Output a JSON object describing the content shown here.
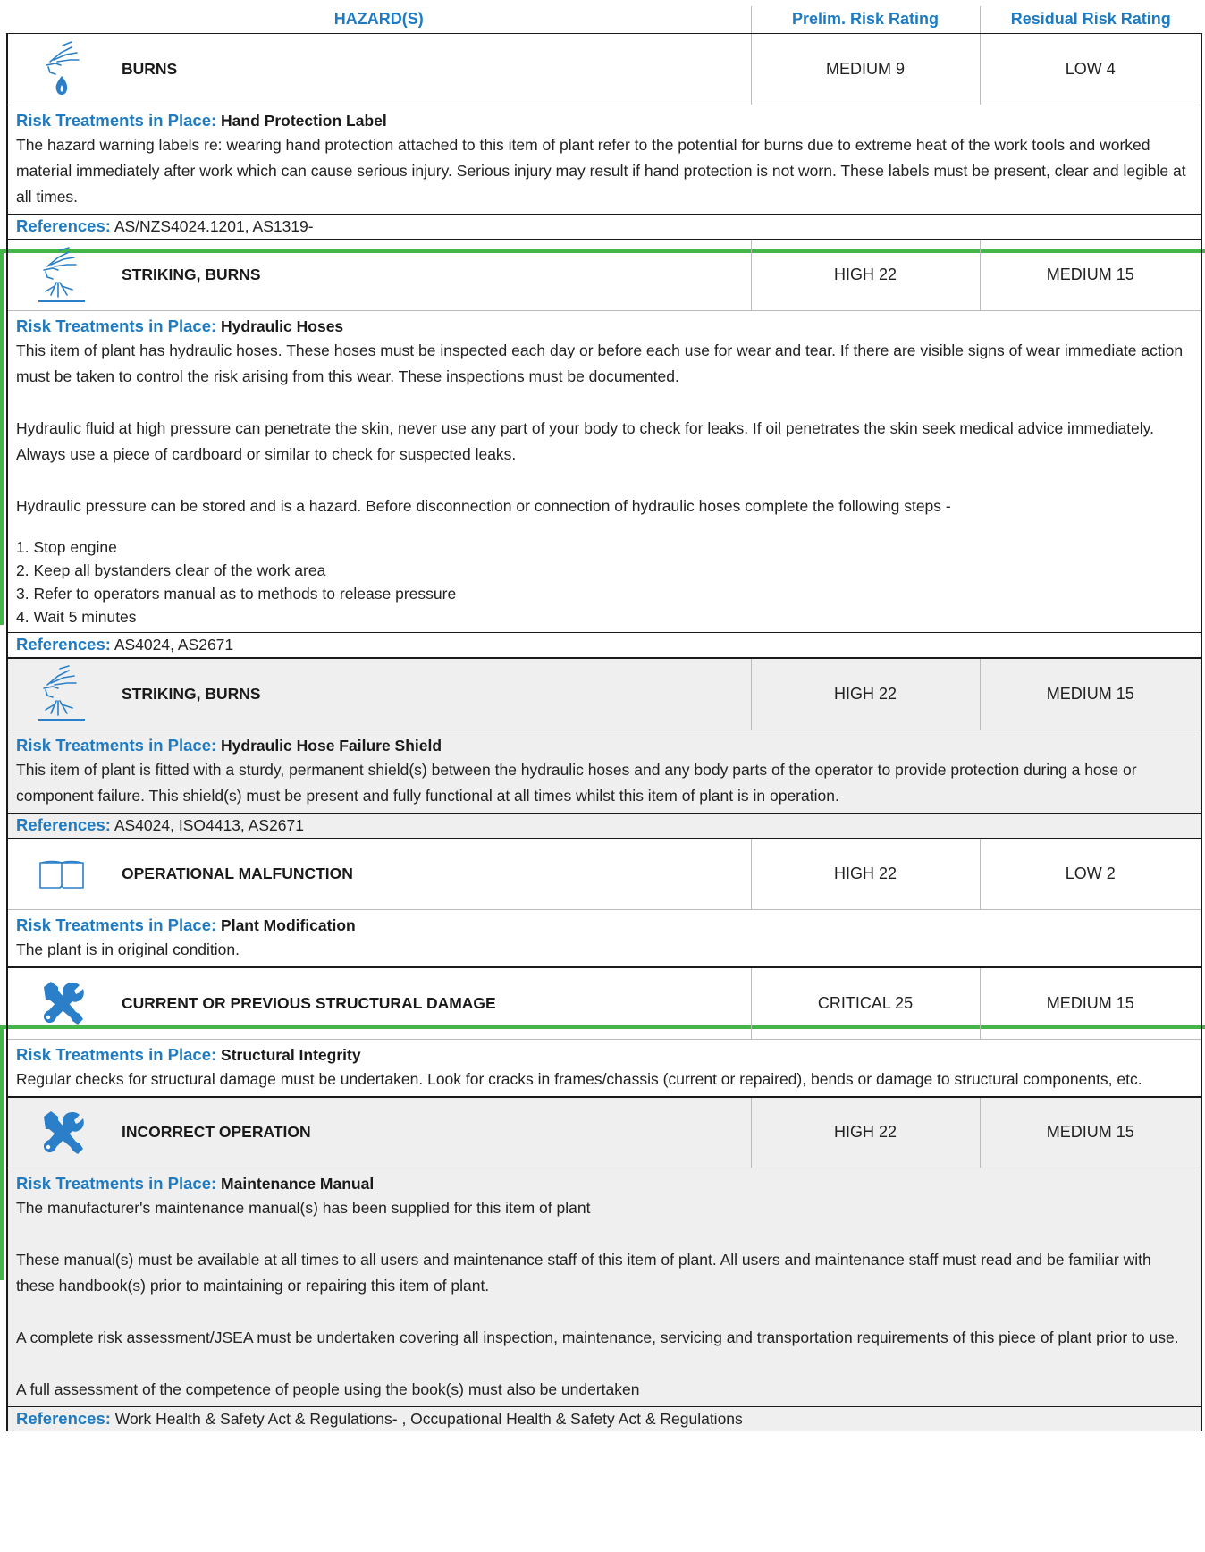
{
  "header": {
    "hazards": "HAZARD(S)",
    "prelim": "Prelim. Risk Rating",
    "residual": "Residual Risk Rating"
  },
  "labels": {
    "treatments": "Risk Treatments in Place:",
    "references": "References:"
  },
  "rows": [
    {
      "icon": "hand-burn-icon",
      "hazard": "BURNS",
      "prelim": "MEDIUM 9",
      "residual": "LOW 4",
      "treatment": "Hand Protection Label",
      "paragraphs": [
        "The hazard warning labels re: wearing hand protection attached to this item of plant refer to the potential for burns due to extreme heat of the work tools and worked material immediately after work which can cause serious injury. Serious injury may result if hand protection is not worn. These labels must be present, clear and legible at all times."
      ],
      "references": "AS/NZS4024.1201, AS1319-"
    },
    {
      "icon": "hand-spray-icon",
      "hazard": "STRIKING, BURNS",
      "prelim": "HIGH 22",
      "residual": "MEDIUM 15",
      "treatment": "Hydraulic Hoses",
      "paragraphs": [
        "This item of plant has hydraulic hoses. These hoses must be inspected each day or before each use for wear and tear. If there are visible signs of wear immediate action must be taken to control the risk arising from this wear. These inspections must be documented.",
        "Hydraulic fluid at high pressure can penetrate the skin, never use any part of your body to check for leaks. If oil penetrates the skin seek medical advice immediately. Always use a piece of cardboard or similar to check for suspected leaks.",
        "Hydraulic pressure can be stored and is a hazard. Before disconnection or connection of hydraulic hoses complete the following steps -"
      ],
      "list": [
        "1. Stop engine",
        "2. Keep all bystanders clear of the work area",
        "3. Refer to operators manual as to methods to release pressure",
        "4. Wait 5 minutes"
      ],
      "references": "AS4024, AS2671"
    },
    {
      "icon": "hand-spray-icon",
      "hazard": "STRIKING, BURNS",
      "prelim": "HIGH 22",
      "residual": "MEDIUM 15",
      "treatment": "Hydraulic Hose Failure Shield",
      "paragraphs": [
        "This item of plant is fitted with a sturdy, permanent shield(s) between the hydraulic hoses and any body parts of the operator to provide protection during a hose or component failure. This shield(s) must be present and fully functional at all times whilst this item of plant is in operation."
      ],
      "references": "AS4024, ISO4413, AS2671"
    },
    {
      "icon": "book-icon",
      "hazard": "OPERATIONAL MALFUNCTION",
      "prelim": "HIGH 22",
      "residual": "LOW 2",
      "treatment": "Plant Modification",
      "paragraphs": [
        "The plant is in original condition."
      ]
    },
    {
      "icon": "tools-icon",
      "hazard": "CURRENT OR PREVIOUS STRUCTURAL DAMAGE",
      "prelim": "CRITICAL 25",
      "residual": "MEDIUM 15",
      "treatment": "Structural Integrity",
      "paragraphs": [
        "Regular checks for structural damage must be undertaken. Look for cracks in frames/chassis (current or repaired), bends or damage to structural components, etc."
      ]
    },
    {
      "icon": "tools-icon",
      "hazard": "INCORRECT OPERATION",
      "prelim": "HIGH 22",
      "residual": "MEDIUM 15",
      "treatment": "Maintenance Manual",
      "paragraphs": [
        "The manufacturer's maintenance manual(s) has been supplied for this item of plant",
        "These manual(s) must be available at all times to all users and maintenance staff of this item of plant. All users and maintenance staff must read and be familiar with these handbook(s) prior to maintaining or repairing this item of plant.",
        "A complete risk assessment/JSEA must be undertaken covering all inspection, maintenance, servicing and transportation requirements of this piece of plant prior to use.",
        "A full assessment of the competence of people using the book(s) must also be undertaken"
      ],
      "references": "Work Health & Safety Act & Regulations- , Occupational Health & Safety Act & Regulations"
    }
  ],
  "colors": {
    "accent_blue": "#1f7bc1",
    "green_marker": "#44b649",
    "gray_row": "#efefef"
  }
}
